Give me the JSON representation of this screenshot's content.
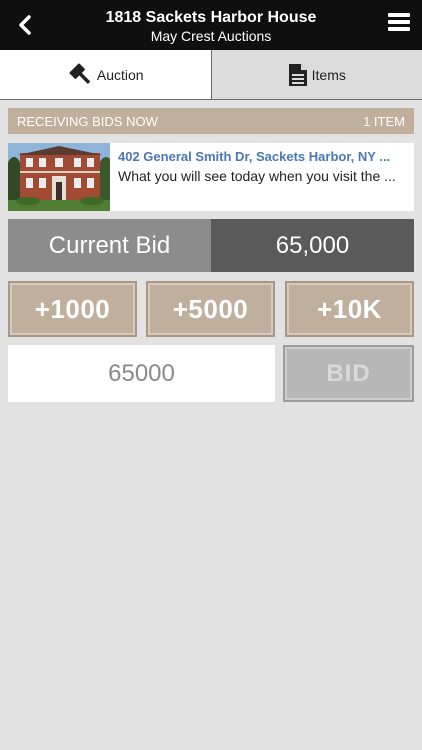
{
  "header": {
    "title": "1818 Sackets Harbor House",
    "subtitle": "May Crest Auctions"
  },
  "tabs": [
    {
      "label": "Auction",
      "icon": "gavel-icon",
      "active": true
    },
    {
      "label": "Items",
      "icon": "document-icon",
      "active": false
    }
  ],
  "banner": {
    "status": "RECEIVING BIDS NOW",
    "count": "1 ITEM"
  },
  "item": {
    "address": "402 General Smith Dr, Sackets Harbor, NY ...",
    "description": "What you will see today when you visit the ..."
  },
  "current_bid": {
    "label": "Current Bid",
    "value": "65,000"
  },
  "increments": [
    "+1000",
    "+5000",
    "+10K"
  ],
  "bid_form": {
    "input_value": "65000",
    "button_label": "BID"
  },
  "colors": {
    "header_bg": "#0f0f0f",
    "accent_tan": "#bfaf9c",
    "link_blue": "#4a78b4",
    "current_label_bg": "#8c8c8c",
    "current_value_bg": "#5a5a5a",
    "page_bg": "#e2e2e2"
  }
}
